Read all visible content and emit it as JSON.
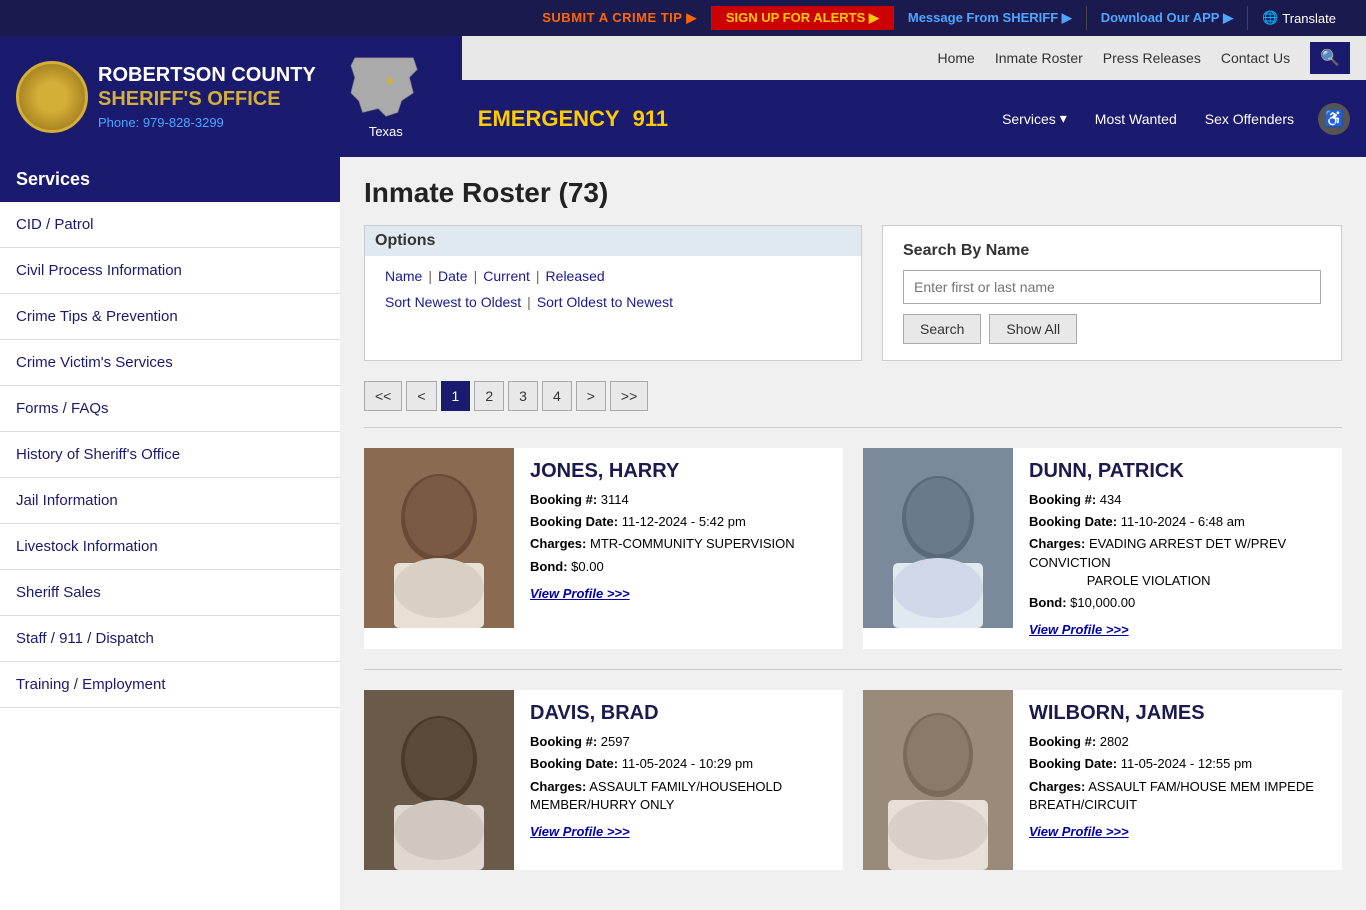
{
  "alert_bar": {
    "crime_tip": "SUBMIT A CRIME TIP",
    "crime_tip_icon": "▶",
    "sign_up": "SIGN UP FOR ALERTS",
    "sign_up_icon": "▶",
    "sheriff_msg": "Message From SHERIFF",
    "sheriff_msg_icon": "▶",
    "download_app": "Download Our APP",
    "download_app_icon": "▶",
    "translate": "Translate"
  },
  "header": {
    "county": "ROBERTSON COUNTY",
    "office": "SHERIFF'S OFFICE",
    "phone_label": "Phone:",
    "phone": "979-828-3299",
    "texas_label": "Texas",
    "emergency_label": "EMERGENCY",
    "emergency_number": "911",
    "nav": {
      "home": "Home",
      "inmate_roster": "Inmate Roster",
      "press_releases": "Press Releases",
      "contact_us": "Contact Us"
    },
    "bottom_nav": {
      "services": "Services",
      "most_wanted": "Most Wanted",
      "sex_offenders": "Sex Offenders"
    }
  },
  "sidebar": {
    "header": "Services",
    "items": [
      {
        "label": "CID / Patrol"
      },
      {
        "label": "Civil Process Information"
      },
      {
        "label": "Crime Tips & Prevention"
      },
      {
        "label": "Crime Victim's Services"
      },
      {
        "label": "Forms / FAQs"
      },
      {
        "label": "History of Sheriff's Office"
      },
      {
        "label": "Jail Information"
      },
      {
        "label": "Livestock Information"
      },
      {
        "label": "Sheriff Sales"
      },
      {
        "label": "Staff / 911 / Dispatch"
      },
      {
        "label": "Training / Employment"
      }
    ]
  },
  "content": {
    "page_title": "Inmate Roster (73)",
    "options": {
      "heading": "Options",
      "links": [
        "Name",
        "Date",
        "Current",
        "Released"
      ],
      "sort_links": [
        "Sort Newest to Oldest",
        "Sort Oldest to Newest"
      ]
    },
    "search": {
      "heading": "Search By Name",
      "placeholder": "Enter first or last name",
      "search_btn": "Search",
      "show_all_btn": "Show All"
    },
    "pagination": {
      "first": "<<",
      "prev": "<",
      "pages": [
        "1",
        "2",
        "3",
        "4"
      ],
      "active_page": "1",
      "next": ">",
      "last": ">>"
    },
    "inmates": [
      {
        "name": "JONES, HARRY",
        "booking_num": "3114",
        "booking_date": "11-12-2024 - 5:42 pm",
        "charges": "MTR-COMMUNITY SUPERVISION",
        "bond": "$0.00",
        "view_profile": "View Profile >>>",
        "mugshot_class": "mugshot-1"
      },
      {
        "name": "DUNN, PATRICK",
        "booking_num": "434",
        "booking_date": "11-10-2024 - 6:48 am",
        "charges": "EVADING ARREST DET W/PREV CONVICTION\nPAROLE VIOLATION",
        "bond": "$10,000.00",
        "view_profile": "View Profile >>>",
        "mugshot_class": "mugshot-2"
      },
      {
        "name": "DAVIS, BRAD",
        "booking_num": "2597",
        "booking_date": "11-05-2024 - 10:29 pm",
        "charges": "ASSAULT FAMILY/HOUSEHOLD MEMBER/HURRY ONLY",
        "bond": "",
        "view_profile": "View Profile >>>",
        "mugshot_class": "mugshot-3"
      },
      {
        "name": "WILBORN, JAMES",
        "booking_num": "2802",
        "booking_date": "11-05-2024 - 12:55 pm",
        "charges": "ASSAULT FAM/HOUSE MEM IMPEDE BREATH/CIRCUIT",
        "bond": "",
        "view_profile": "View Profile >>>",
        "mugshot_class": "mugshot-4"
      }
    ]
  }
}
